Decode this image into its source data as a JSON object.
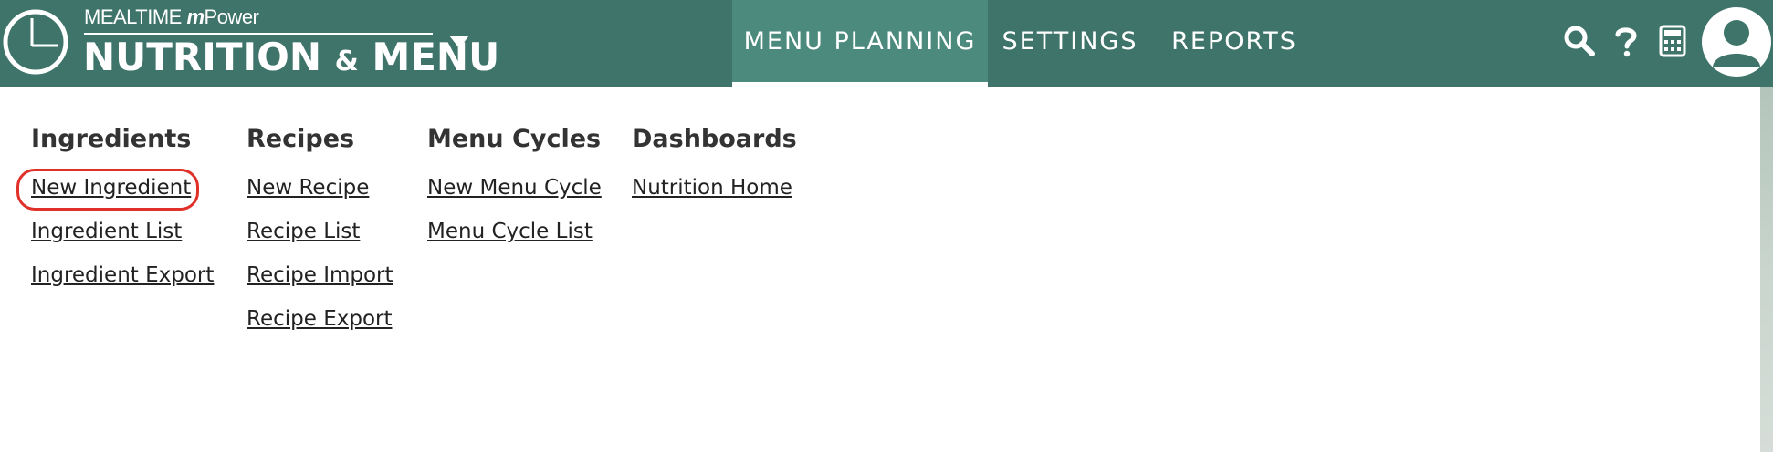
{
  "brand": {
    "small_prefix": "MEALTIME",
    "small_m": "m",
    "small_suffix": "Power",
    "big_left": "NUTRITION",
    "big_amp": "&",
    "big_right": "MENU"
  },
  "nav": {
    "tabs": [
      {
        "label": "MENU PLANNING",
        "active": true
      },
      {
        "label": "SETTINGS",
        "active": false
      },
      {
        "label": "REPORTS",
        "active": false
      }
    ]
  },
  "icons": {
    "search": "search-icon",
    "help": "help-icon",
    "calculator": "calculator-icon",
    "avatar": "user-avatar-icon"
  },
  "colors": {
    "topbar": "#3e7469",
    "active_tab": "#4c8a7d",
    "highlight": "#e0302a"
  },
  "menu": {
    "columns": [
      {
        "heading": "Ingredients",
        "links": [
          "New Ingredient",
          "Ingredient List",
          "Ingredient Export"
        ]
      },
      {
        "heading": "Recipes",
        "links": [
          "New Recipe",
          "Recipe List",
          "Recipe Import",
          "Recipe Export"
        ]
      },
      {
        "heading": "Menu Cycles",
        "links": [
          "New Menu Cycle",
          "Menu Cycle List"
        ]
      },
      {
        "heading": "Dashboards",
        "links": [
          "Nutrition Home"
        ]
      }
    ]
  }
}
